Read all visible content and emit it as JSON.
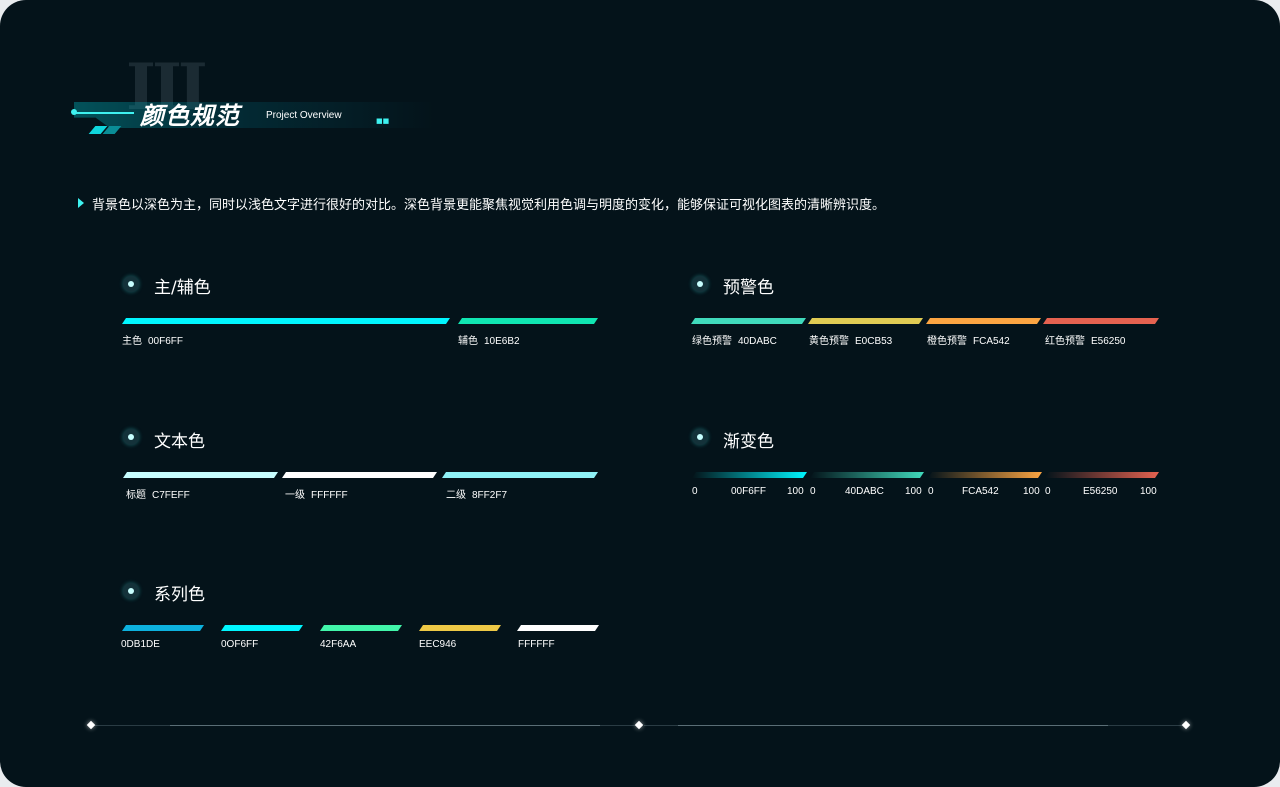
{
  "header": {
    "roman": "III",
    "title": "颜色规范",
    "subtitle": "Project Overview",
    "mark": "■■"
  },
  "intro": "背景色以深色为主，同时以浅色文字进行很好的对比。深色背景更能聚焦视觉利用色调与明度的变化，能够保证可视化图表的清晰辨识度。",
  "sections": {
    "primary": {
      "title": "主/辅色",
      "items": [
        {
          "name": "主色",
          "code": "00F6FF",
          "color": "#00F6FF"
        },
        {
          "name": "辅色",
          "code": "10E6B2",
          "color": "#10E6B2"
        }
      ]
    },
    "warning": {
      "title": "预警色",
      "items": [
        {
          "name": "绿色预警",
          "code": "40DABC",
          "color": "#40DABC"
        },
        {
          "name": "黄色预警",
          "code": "E0CB53",
          "color": "#E0CB53"
        },
        {
          "name": "橙色预警",
          "code": "FCA542",
          "color": "#FCA542"
        },
        {
          "name": "红色预警",
          "code": "E56250",
          "color": "#E56250"
        }
      ]
    },
    "text": {
      "title": "文本色",
      "items": [
        {
          "name": "标题",
          "code": "C7FEFF",
          "color": "#C7FEFF"
        },
        {
          "name": "一级",
          "code": "FFFFFF",
          "color": "#FFFFFF"
        },
        {
          "name": "二级",
          "code": "8FF2F7",
          "color": "#8FF2F7"
        }
      ]
    },
    "gradient": {
      "title": "渐变色",
      "items": [
        {
          "start": "0",
          "code": "00F6FF",
          "end": "100",
          "color": "#00F6FF"
        },
        {
          "start": "0",
          "code": "40DABC",
          "end": "100",
          "color": "#40DABC"
        },
        {
          "start": "0",
          "code": "FCA542",
          "end": "100",
          "color": "#FCA542"
        },
        {
          "start": "0",
          "code": "E56250",
          "end": "100",
          "color": "#E56250"
        }
      ]
    },
    "series": {
      "title": "系列色",
      "items": [
        {
          "code": "0DB1DE",
          "color": "#0DB1DE"
        },
        {
          "code": "0OF6FF",
          "color": "#00F6FF"
        },
        {
          "code": "42F6AA",
          "color": "#42F6AA"
        },
        {
          "code": "EEC946",
          "color": "#EEC946"
        },
        {
          "code": "FFFFFF",
          "color": "#FFFFFF"
        }
      ]
    }
  },
  "colors": {
    "background": "#04131A",
    "accent": "#3EF2F0"
  }
}
